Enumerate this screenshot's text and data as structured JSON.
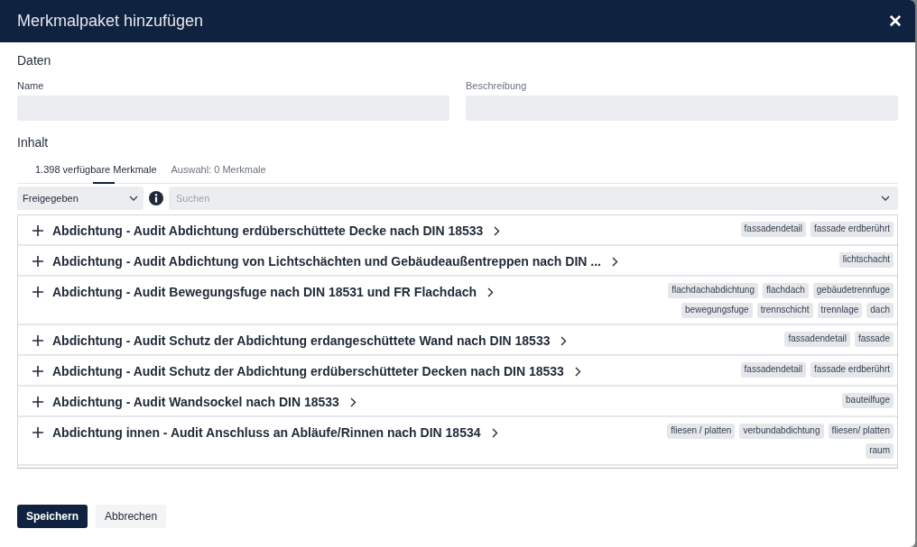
{
  "dialog": {
    "title": "Merkmalpaket hinzufügen",
    "close": "✕"
  },
  "data_section": {
    "heading": "Daten",
    "fields": [
      {
        "label": "Name"
      },
      {
        "label": "Beschreibung"
      }
    ]
  },
  "content_section": {
    "heading": "Inhalt",
    "tabs": [
      {
        "label": "1.398 verfügbare Merkmale",
        "selected": true
      },
      {
        "label": "Auswahl: 0 Merkmale",
        "selected": false
      }
    ],
    "filter": {
      "value": "Freigegeben"
    },
    "search": {
      "placeholder": "Suchen"
    },
    "items": [
      {
        "title": "Abdichtung - Audit Abdichtung erdüberschüttete Decke nach DIN 18533",
        "tags": [
          "fassadendetail",
          "fassade erdberührt"
        ]
      },
      {
        "title": "Abdichtung - Audit Abdichtung von Lichtschächten und Gebäudeaußentreppen nach DIN ...",
        "tags": [
          "lichtschacht"
        ]
      },
      {
        "title": "Abdichtung - Audit Bewegungsfuge nach DIN 18531 und FR Flachdach",
        "tags": [
          "flachdachabdichtung",
          "flachdach",
          "gebäudetrennfuge",
          "bewegungsfuge",
          "trennschicht",
          "trennlage",
          "dach"
        ]
      },
      {
        "title": "Abdichtung - Audit Schutz der Abdichtung erdangeschüttete Wand nach DIN 18533",
        "tags": [
          "fassadendetail",
          "fassade"
        ]
      },
      {
        "title": "Abdichtung - Audit Schutz der Abdichtung erdüberschütteter Decken nach DIN 18533",
        "tags": [
          "fassadendetail",
          "fassade erdberührt"
        ]
      },
      {
        "title": "Abdichtung - Audit Wandsockel nach DIN 18533",
        "tags": [
          "bauteilfuge"
        ]
      },
      {
        "title": "Abdichtung innen - Audit Anschluss an Abläufe/Rinnen nach DIN 18534",
        "tags": [
          "fliesen / platten",
          "verbundabdichtung",
          "fliesen/ platten",
          "raum"
        ]
      }
    ]
  },
  "buttons": [
    {
      "label": "Speichern",
      "kind": "primary"
    },
    {
      "label": "Abbrechen",
      "kind": "secondary"
    }
  ]
}
